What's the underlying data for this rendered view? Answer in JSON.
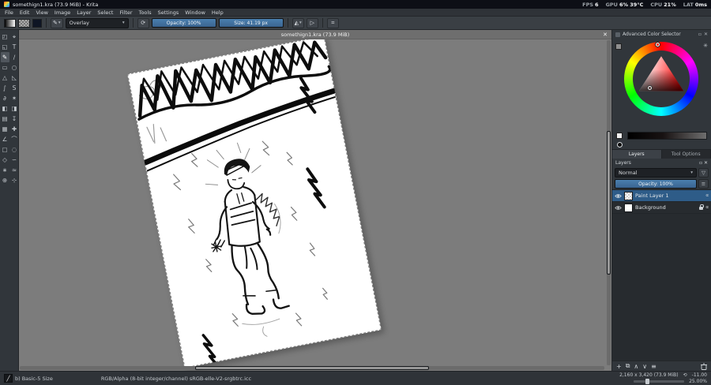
{
  "colors": {
    "accent": "#3daee9",
    "slider_fill": "#3f6fa0",
    "selected_layer": "#2e5c88",
    "canvas_bg": "#7c7c7c"
  },
  "titlebar": {
    "title": "somethign1.kra (73.9 MiB) - Krita",
    "stats": [
      {
        "label": "FPS",
        "value": "6"
      },
      {
        "label": "GPU",
        "value": "6% 39°C"
      },
      {
        "label": "CPU",
        "value": "21%"
      },
      {
        "label": "LAT",
        "value": "0ms"
      }
    ]
  },
  "menubar": {
    "items": [
      {
        "label": "File"
      },
      {
        "label": "Edit"
      },
      {
        "label": "View"
      },
      {
        "label": "Image"
      },
      {
        "label": "Layer"
      },
      {
        "label": "Select"
      },
      {
        "label": "Filter"
      },
      {
        "label": "Tools"
      },
      {
        "label": "Settings"
      },
      {
        "label": "Window"
      },
      {
        "label": "Help"
      }
    ]
  },
  "toolbar": {
    "blend_mode": "Overlay",
    "opacity": "Opacity: 100%",
    "size": "Size: 41.19 px"
  },
  "toolbox": {
    "tools": [
      {
        "name": "transform-tool",
        "glyph": "◰"
      },
      {
        "name": "move-tool",
        "glyph": "⌖"
      },
      {
        "name": "crop-tool",
        "glyph": "◱"
      },
      {
        "name": "text-tool",
        "glyph": "T"
      },
      {
        "name": "freehand-brush-tool",
        "glyph": "✎"
      },
      {
        "name": "line-tool",
        "glyph": "∕"
      },
      {
        "name": "rectangle-tool",
        "glyph": "▭"
      },
      {
        "name": "ellipse-tool",
        "glyph": "○"
      },
      {
        "name": "polygon-tool",
        "glyph": "△"
      },
      {
        "name": "polyline-tool",
        "glyph": "◺"
      },
      {
        "name": "bezier-curve-tool",
        "glyph": "∫"
      },
      {
        "name": "freehand-path-tool",
        "glyph": "S"
      },
      {
        "name": "dynamic-brush-tool",
        "glyph": "∂"
      },
      {
        "name": "multibrush-tool",
        "glyph": "✶"
      },
      {
        "name": "fill-tool",
        "glyph": "◧"
      },
      {
        "name": "enclose-fill-tool",
        "glyph": "◨"
      },
      {
        "name": "gradient-tool",
        "glyph": "▤"
      },
      {
        "name": "color-sampler-tool",
        "glyph": "↧"
      },
      {
        "name": "pattern-editing-tool",
        "glyph": "▦"
      },
      {
        "name": "smart-patch-tool",
        "glyph": "✚"
      },
      {
        "name": "measure-tool",
        "glyph": "∠"
      },
      {
        "name": "assistants-tool",
        "glyph": "⌒"
      },
      {
        "name": "rectangular-selection-tool",
        "glyph": "▢"
      },
      {
        "name": "elliptical-selection-tool",
        "glyph": "◌"
      },
      {
        "name": "polygonal-selection-tool",
        "glyph": "◇"
      },
      {
        "name": "freehand-selection-tool",
        "glyph": "∽"
      },
      {
        "name": "contiguous-selection-tool",
        "glyph": "∗"
      },
      {
        "name": "similar-color-selection-tool",
        "glyph": "≈"
      },
      {
        "name": "zoom-tool",
        "glyph": "⊕"
      },
      {
        "name": "pan-tool",
        "glyph": "⊹"
      }
    ]
  },
  "document": {
    "tab_title": "somethign1.kra (73.9 MiB)"
  },
  "color_docker": {
    "title": "Advanced Color Selector"
  },
  "layers_docker": {
    "tabs": [
      {
        "label": "Layers"
      },
      {
        "label": "Tool Options"
      }
    ],
    "header": "Layers",
    "blend_mode": "Normal",
    "opacity_label": "Opacity:  100%",
    "layers": [
      {
        "name": "Paint Layer 1"
      },
      {
        "name": "Background"
      }
    ]
  },
  "statusbar": {
    "brush_preset": "b) Basic-5 Size",
    "colorspace": "RGB/Alpha (8-bit integer/channel)  sRGB-elle-V2-srgbtrc.icc",
    "dimensions": "2,160 x 3,420 (73.9 MiB)",
    "rotation": "-11.00",
    "zoom": "25.00%"
  },
  "icons": {
    "dropdown": "▾",
    "close": "✕",
    "reload": "⟳",
    "mirror_h": "◭",
    "mirror_v": "▷",
    "wrap": "⌗",
    "funnel": "▽",
    "menu": "≡",
    "gear": "✳",
    "float": "▫",
    "alpha": "α",
    "rotate": "⟲",
    "add": "+",
    "duplicate": "⧉",
    "move_up": "∧",
    "move_down": "∨",
    "properties": "≡"
  }
}
